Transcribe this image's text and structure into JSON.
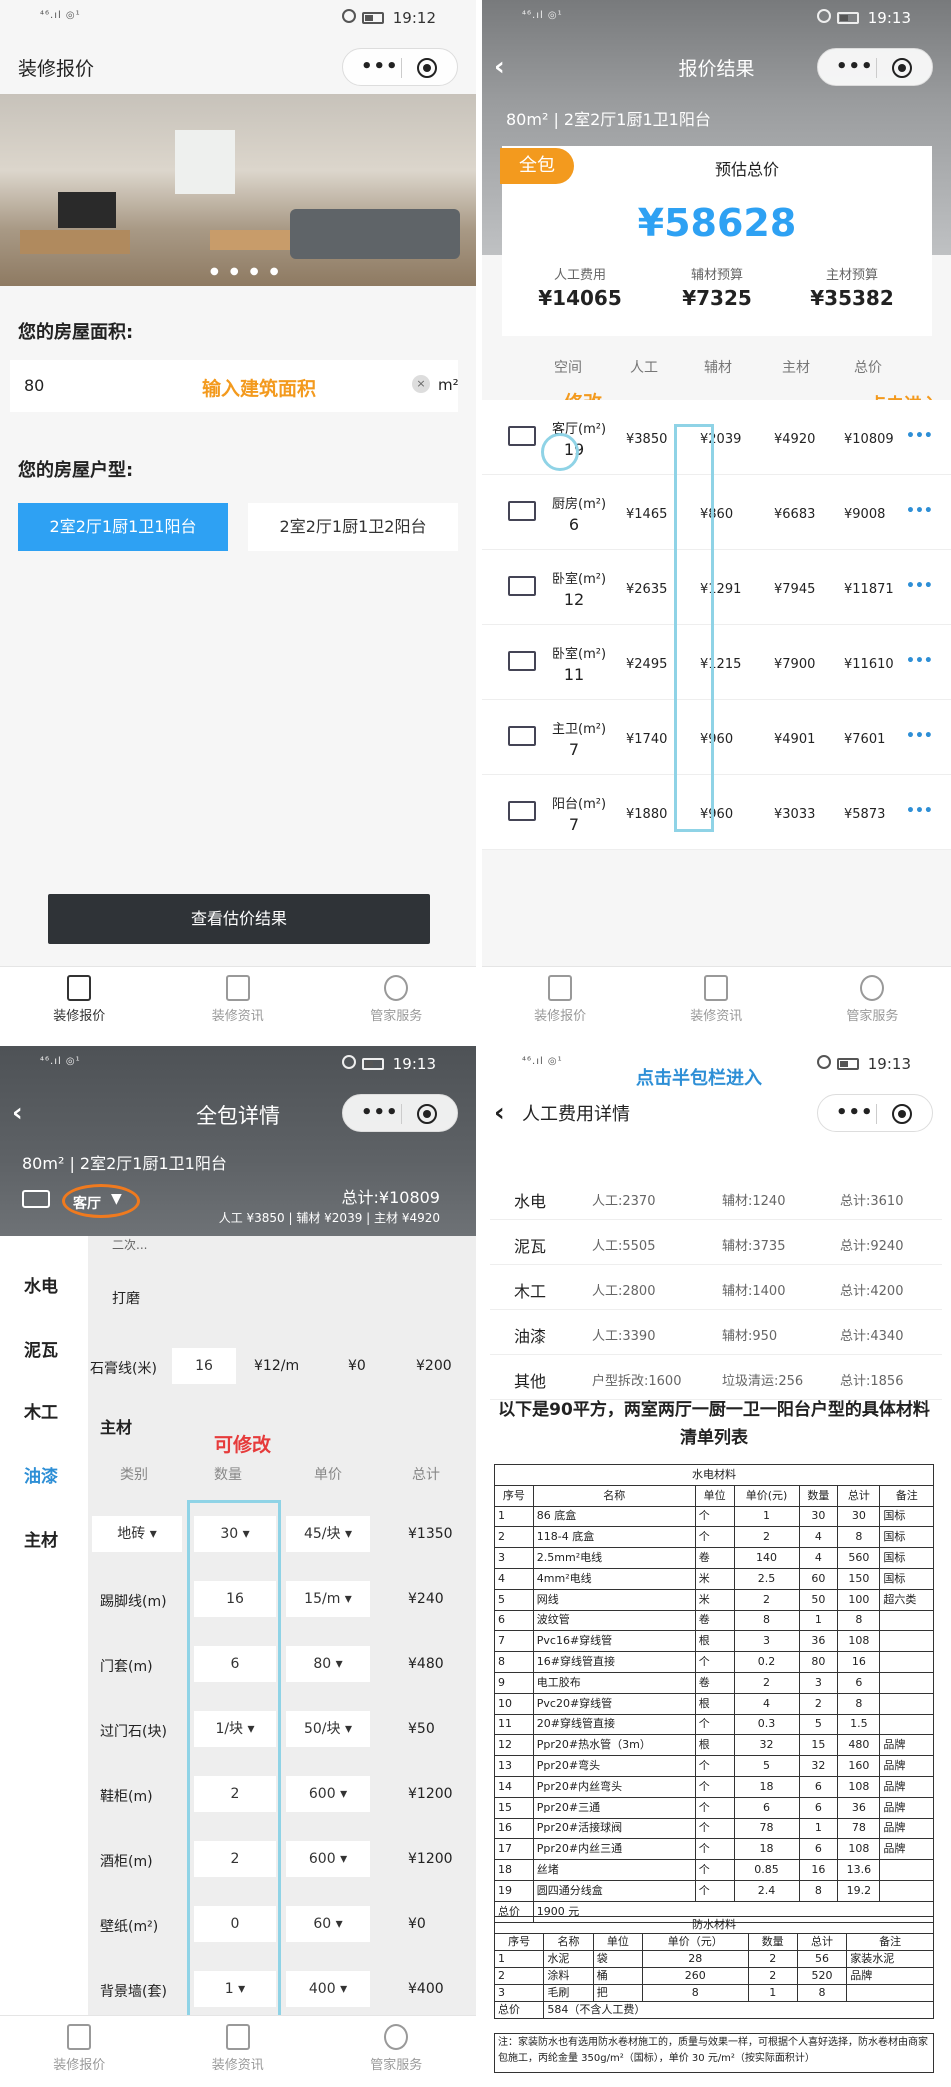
{
  "status": {
    "signal": "⁴⁶.ıl ◎¹",
    "time1": "19:12",
    "time2": "19:13",
    "time3": "19:13",
    "time4": "19:13"
  },
  "p1": {
    "title": "装修报价",
    "area_label": "您的房屋面积:",
    "area_value": "80",
    "area_hint": "输入建筑面积",
    "area_unit": "m²",
    "type_label": "您的房屋户型:",
    "type_option1": "2室2厅1厨1卫1阳台",
    "type_option2": "2室2厅1厨1卫2阳台",
    "result_button": "查看估价结果"
  },
  "tabs": [
    "装修报价",
    "装修资讯",
    "管家服务"
  ],
  "p2": {
    "title": "报价结果",
    "subtitle": "80m² | 2室2厅1厨1卫1阳台",
    "badge": "全包",
    "total_label": "预估总价",
    "total": "¥58628",
    "labor_label": "人工费用",
    "labor": "¥14065",
    "aux_label": "辅材预算",
    "aux": "¥7325",
    "main_label": "主材预算",
    "main": "¥35382",
    "headers": [
      "空间",
      "人工",
      "辅材",
      "主材",
      "总价"
    ],
    "ann_modify": "修改",
    "ann_enter": "点击进入",
    "rows": [
      {
        "room": "客厅(m²)",
        "area": "19",
        "labor": "¥3850",
        "aux": "¥2039",
        "main": "¥4920",
        "total": "¥10809"
      },
      {
        "room": "厨房(m²)",
        "area": "6",
        "labor": "¥1465",
        "aux": "¥860",
        "main": "¥6683",
        "total": "¥9008"
      },
      {
        "room": "卧室(m²)",
        "area": "12",
        "labor": "¥2635",
        "aux": "¥1291",
        "main": "¥7945",
        "total": "¥11871"
      },
      {
        "room": "卧室(m²)",
        "area": "11",
        "labor": "¥2495",
        "aux": "¥1215",
        "main": "¥7900",
        "total": "¥11610"
      },
      {
        "room": "主卫(m²)",
        "area": "7",
        "labor": "¥1740",
        "aux": "¥960",
        "main": "¥4901",
        "total": "¥7601"
      },
      {
        "room": "阳台(m²)",
        "area": "7",
        "labor": "¥1880",
        "aux": "¥960",
        "main": "¥3033",
        "total": "¥5873"
      }
    ]
  },
  "p3": {
    "title": "全包详情",
    "subtitle": "80m² | 2室2厅1厨1卫1阳台",
    "room": "客厅",
    "total": "总计:¥10809",
    "breakdown": "人工 ¥3850 | 辅材 ¥2039 | 主材 ¥4920",
    "side": [
      "水电",
      "泥瓦",
      "木工",
      "油漆",
      "主材"
    ],
    "partial": "二次...",
    "polish": "打磨",
    "gypsum_name": "石膏线(米)",
    "gypsum_qty": "16",
    "gypsum_price": "¥12/m",
    "gypsum_zero": "¥0",
    "gypsum_total": "¥200",
    "section": "主材",
    "ann_editable": "可修改",
    "cols": [
      "类别",
      "数量",
      "单价",
      "总计"
    ],
    "items": [
      {
        "name": "地砖",
        "qty": "30",
        "price": "45/块",
        "total": "¥1350"
      },
      {
        "name": "踢脚线(m)",
        "qty": "16",
        "price": "15/m",
        "total": "¥240"
      },
      {
        "name": "门套(m)",
        "qty": "6",
        "price": "80",
        "total": "¥480"
      },
      {
        "name": "过门石(块)",
        "qty": "1/块",
        "price": "50/块",
        "total": "¥50"
      },
      {
        "name": "鞋柜(m)",
        "qty": "2",
        "price": "600",
        "total": "¥1200"
      },
      {
        "name": "酒柜(m)",
        "qty": "2",
        "price": "600",
        "total": "¥1200"
      },
      {
        "name": "壁纸(m²)",
        "qty": "0",
        "price": "60",
        "total": "¥0"
      },
      {
        "name": "背景墙(套)",
        "qty": "1",
        "price": "400",
        "total": "¥400"
      }
    ]
  },
  "p4": {
    "ann_half": "点击半包栏进入",
    "title": "人工费用详情",
    "rows": [
      {
        "cat": "水电",
        "a": "人工:2370",
        "b": "辅材:1240",
        "c": "总计:3610"
      },
      {
        "cat": "泥瓦",
        "a": "人工:5505",
        "b": "辅材:3735",
        "c": "总计:9240"
      },
      {
        "cat": "木工",
        "a": "人工:2800",
        "b": "辅材:1400",
        "c": "总计:4200"
      },
      {
        "cat": "油漆",
        "a": "人工:3390",
        "b": "辅材:950",
        "c": "总计:4340"
      },
      {
        "cat": "其他",
        "a": "户型拆改:1600",
        "b": "垃圾清运:256",
        "c": "总计:1856"
      }
    ],
    "heading": "以下是90平方，两室两厅一厨一卫一阳台户型的具体材料清单列表",
    "water_title": "水电材料",
    "water_head": [
      "序号",
      "名称",
      "单位",
      "单价(元)",
      "数量",
      "总计",
      "备注"
    ],
    "water": [
      [
        "1",
        "86 底盒",
        "个",
        "1",
        "30",
        "30",
        "国标"
      ],
      [
        "2",
        "118-4 底盒",
        "个",
        "2",
        "4",
        "8",
        "国标"
      ],
      [
        "3",
        "2.5mm²电线",
        "卷",
        "140",
        "4",
        "560",
        "国标"
      ],
      [
        "4",
        "4mm²电线",
        "米",
        "2.5",
        "60",
        "150",
        "国标"
      ],
      [
        "5",
        "网线",
        "米",
        "2",
        "50",
        "100",
        "超六类"
      ],
      [
        "6",
        "波纹管",
        "卷",
        "8",
        "1",
        "8",
        ""
      ],
      [
        "7",
        "Pvc16#穿线管",
        "根",
        "3",
        "36",
        "108",
        ""
      ],
      [
        "8",
        "16#穿线管直接",
        "个",
        "0.2",
        "80",
        "16",
        ""
      ],
      [
        "9",
        "电工胶布",
        "卷",
        "2",
        "3",
        "6",
        ""
      ],
      [
        "10",
        "Pvc20#穿线管",
        "根",
        "4",
        "2",
        "8",
        ""
      ],
      [
        "11",
        "20#穿线管直接",
        "个",
        "0.3",
        "5",
        "1.5",
        ""
      ],
      [
        "12",
        "Ppr20#热水管（3m）",
        "根",
        "32",
        "15",
        "480",
        "品牌"
      ],
      [
        "13",
        "Ppr20#弯头",
        "个",
        "5",
        "32",
        "160",
        "品牌"
      ],
      [
        "14",
        "Ppr20#内丝弯头",
        "个",
        "18",
        "6",
        "108",
        "品牌"
      ],
      [
        "15",
        "Ppr20#三通",
        "个",
        "6",
        "6",
        "36",
        "品牌"
      ],
      [
        "16",
        "Ppr20#活接球阀",
        "个",
        "78",
        "1",
        "78",
        "品牌"
      ],
      [
        "17",
        "Ppr20#内丝三通",
        "个",
        "18",
        "6",
        "108",
        "品牌"
      ],
      [
        "18",
        "丝堵",
        "个",
        "0.85",
        "16",
        "13.6",
        ""
      ],
      [
        "19",
        "圆四通分线盒",
        "个",
        "2.4",
        "8",
        "19.2",
        ""
      ]
    ],
    "water_total_label": "总价",
    "water_total": "1900 元",
    "proof_title": "防水材料",
    "proof_head": [
      "序号",
      "名称",
      "单位",
      "单价（元）",
      "数量",
      "总计",
      "备注"
    ],
    "proof": [
      [
        "1",
        "水泥",
        "袋",
        "28",
        "2",
        "56",
        "家装水泥"
      ],
      [
        "2",
        "涂料",
        "桶",
        "260",
        "2",
        "520",
        "品牌"
      ],
      [
        "3",
        "毛刷",
        "把",
        "8",
        "1",
        "8",
        ""
      ]
    ],
    "proof_total_label": "总价",
    "proof_total": "584（不含人工费）",
    "note": "注：家装防水也有选用防水卷材施工的，质量与效果一样，可根据个人喜好选择，防水卷材由商家包施工，丙纶金量 350g/m²（国标），单价 30 元/m²（按实际面积计）"
  }
}
